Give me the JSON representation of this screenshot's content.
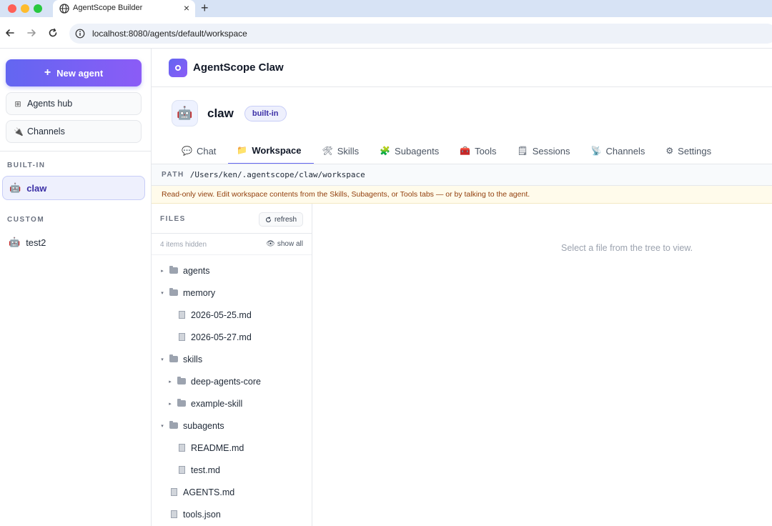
{
  "browser": {
    "tab_title": "AgentScope Builder",
    "tab_close": "×",
    "new_tab": "+",
    "url": "localhost:8080/agents/default/workspace"
  },
  "sidebar": {
    "new_agent_label": "New agent",
    "agents_hub_label": "Agents hub",
    "channels_label": "Channels",
    "builtin_label": "BUILT-IN",
    "custom_label": "CUSTOM",
    "builtin_agents": [
      {
        "name": "claw",
        "icon": "robot-icon"
      }
    ],
    "custom_agents": [
      {
        "name": "test2",
        "icon": "robot-icon"
      }
    ]
  },
  "app": {
    "title": "AgentScope Claw"
  },
  "agent": {
    "name": "claw",
    "badge": "built-in",
    "avatar": "🤖"
  },
  "tabs": [
    {
      "label": "Chat",
      "icon": "💬"
    },
    {
      "label": "Workspace",
      "icon": "📁",
      "active": true
    },
    {
      "label": "Skills",
      "icon": "🛠"
    },
    {
      "label": "Subagents",
      "icon": "🧩"
    },
    {
      "label": "Tools",
      "icon": "🧰"
    },
    {
      "label": "Sessions",
      "icon": "🗒"
    },
    {
      "label": "Channels",
      "icon": "📡"
    },
    {
      "label": "Settings",
      "icon": "⚙"
    }
  ],
  "path": {
    "label": "PATH",
    "value": "/Users/ken/.agentscope/claw/workspace"
  },
  "notice": "Read-only view. Edit workspace contents from the Skills, Subagents, or Tools tabs — or by talking to the agent.",
  "files": {
    "label": "FILES",
    "refresh_label": "refresh",
    "hidden_text": "4 items hidden",
    "show_all_label": "show all",
    "tree": [
      {
        "name": "agents",
        "type": "folder",
        "depth": 0,
        "caret": "▸"
      },
      {
        "name": "memory",
        "type": "folder",
        "depth": 0,
        "caret": "▾"
      },
      {
        "name": "2026-05-25.md",
        "type": "file",
        "depth": 1
      },
      {
        "name": "2026-05-27.md",
        "type": "file",
        "depth": 1
      },
      {
        "name": "skills",
        "type": "folder",
        "depth": 0,
        "caret": "▾"
      },
      {
        "name": "deep-agents-core",
        "type": "folder",
        "depth": 1,
        "caret": "▸"
      },
      {
        "name": "example-skill",
        "type": "folder",
        "depth": 1,
        "caret": "▸"
      },
      {
        "name": "subagents",
        "type": "folder",
        "depth": 0,
        "caret": "▾"
      },
      {
        "name": "README.md",
        "type": "file",
        "depth": 1
      },
      {
        "name": "test.md",
        "type": "file",
        "depth": 1
      },
      {
        "name": "AGENTS.md",
        "type": "file",
        "depth": 0
      },
      {
        "name": "tools.json",
        "type": "file",
        "depth": 0
      }
    ]
  },
  "viewer": {
    "empty_message": "Select a file from the tree to view."
  }
}
